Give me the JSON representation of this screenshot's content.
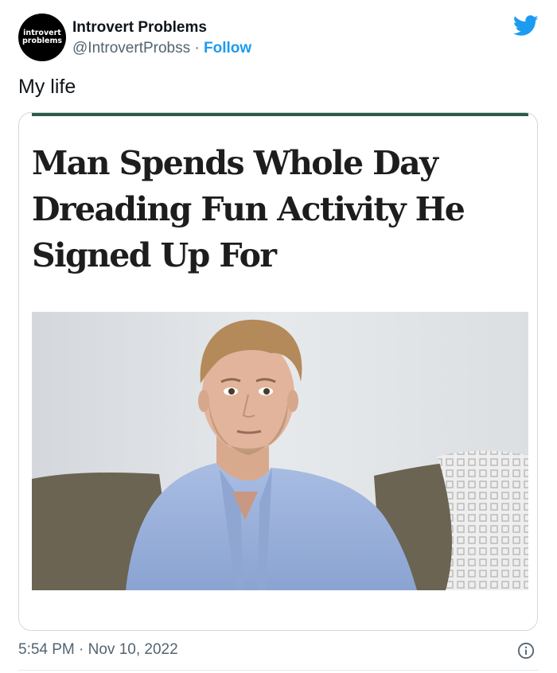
{
  "author": {
    "avatar_line1": "introvert",
    "avatar_line2": "problems",
    "display_name": "Introvert Problems",
    "handle": "@IntrovertProbss",
    "separator": " · ",
    "follow_label": "Follow"
  },
  "tweet": {
    "text": "My life",
    "timestamp": "5:54 PM · Nov 10, 2022"
  },
  "card": {
    "headline": "Man Spends Whole Day Dreading Fun Activity He Signed Up For",
    "accent_color": "#2a5a4a"
  },
  "icons": {
    "brand": "twitter-bird-icon",
    "info": "info-icon"
  },
  "colors": {
    "link": "#1d9bf0",
    "muted": "#536471",
    "text": "#0f1419"
  }
}
